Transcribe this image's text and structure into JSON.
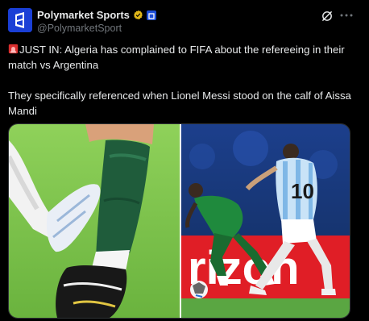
{
  "post": {
    "author": {
      "display_name": "Polymarket Sports",
      "handle": "@PolymarketSport",
      "avatar_icon": "polymarket-logo-icon",
      "verified_icon": "gold-verified-badge-icon",
      "affiliate_icon": "affiliate-badge-icon"
    },
    "actions": {
      "grok_icon": "grok-icon",
      "more_icon": "more-options-icon"
    },
    "text": {
      "line1_prefix": "JUST IN: Algeria has complained to FIFA about the refereeing in their match vs Argentina",
      "line2": "They specifically referenced when Lionel Messi stood on the calf of Aissa Mandi"
    },
    "media": {
      "left_image": "close-up-soccer-cleats-photo",
      "right_image": "match-action-photo",
      "ad_board_text": "rizon",
      "jersey_number": "10"
    }
  },
  "colors": {
    "background": "#000000",
    "text": "#e7e9ea",
    "secondary_text": "#71767b",
    "brand_blue": "#1a3fd6"
  }
}
